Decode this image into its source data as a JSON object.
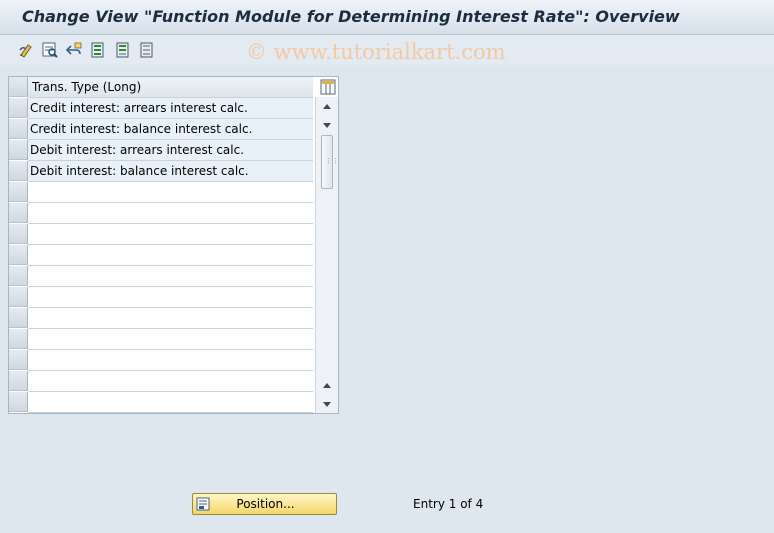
{
  "window": {
    "title": "Change View \"Function Module for Determining Interest Rate\": Overview"
  },
  "toolbar": {
    "buttons": [
      {
        "icon": "change-display-icon"
      },
      {
        "icon": "details-icon"
      },
      {
        "icon": "undo-change-icon"
      },
      {
        "icon": "select-all-icon"
      },
      {
        "icon": "select-block-icon"
      },
      {
        "icon": "deselect-all-icon"
      }
    ]
  },
  "watermark": "© www.tutorialkart.com",
  "table": {
    "column_header": "Trans. Type (Long)",
    "rows": [
      "Credit interest: arrears interest calc.",
      "Credit interest: balance interest calc.",
      "Debit interest: arrears interest calc.",
      "Debit interest: balance interest calc."
    ],
    "empty_rows": 11
  },
  "footer": {
    "position_button": "Position...",
    "entry_info": "Entry 1 of 4"
  }
}
